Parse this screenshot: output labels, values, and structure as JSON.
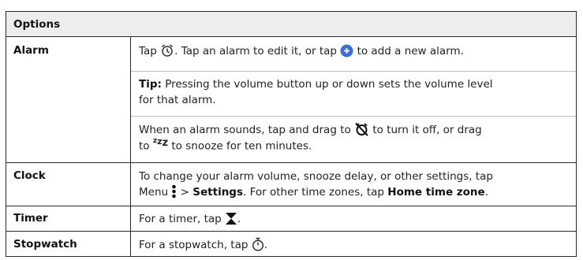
{
  "table": {
    "header": "Options",
    "rows": {
      "alarm": {
        "label": "Alarm",
        "p1": {
          "a": "Tap",
          "b": ". Tap an alarm to edit it, or tap",
          "c": "to add a new alarm."
        },
        "p2": {
          "tip_label": "Tip:",
          "tip_text": "Pressing the volume button up or down sets the volume level",
          "tip_text2": "for that alarm."
        },
        "p3": {
          "a": "When an alarm sounds, tap and drag to",
          "b": "to turn it off, or drag",
          "c": "to",
          "d": "to snooze for ten minutes."
        }
      },
      "clock": {
        "label": "Clock",
        "line1": "To change your alarm volume, snooze delay, or other settings, tap",
        "menu": "Menu",
        "gt": ">",
        "settings": "Settings",
        "mid": ". For other time zones, tap",
        "home_tz": "Home time zone",
        "end": "."
      },
      "timer": {
        "label": "Timer",
        "a": "For a timer, tap",
        "b": "."
      },
      "stopwatch": {
        "label": "Stopwatch",
        "a": "For a stopwatch, tap",
        "b": "."
      }
    }
  },
  "colors": {
    "accent": "#3b6fd8",
    "header_bg": "#ededed",
    "border": "#2a2a2a"
  },
  "icons": [
    "alarm-clock-icon",
    "add-circle-icon",
    "alarm-off-icon",
    "snooze-icon",
    "menu-dots-icon",
    "hourglass-icon",
    "stopwatch-icon"
  ]
}
